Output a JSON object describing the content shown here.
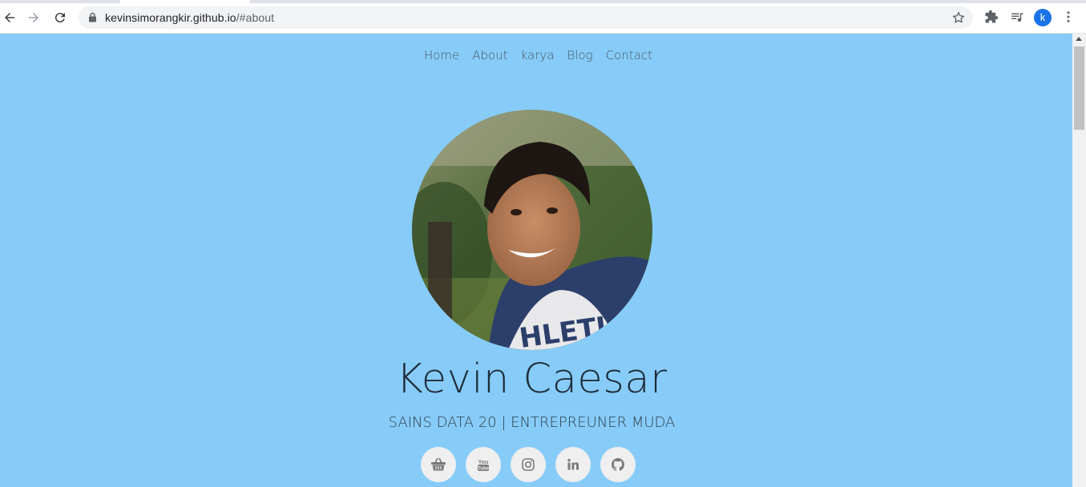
{
  "browser": {
    "url_host": "kevinsimorangkir.github.io",
    "url_path": "/#about",
    "profile_initial": "k"
  },
  "nav": {
    "items": [
      {
        "label": "Home"
      },
      {
        "label": "About"
      },
      {
        "label": "karya"
      },
      {
        "label": "Blog"
      },
      {
        "label": "Contact"
      }
    ]
  },
  "profile": {
    "name": "Kevin Caesar",
    "subtitle": "SAINS DATA 20 | ENTREPREUNER MUDA"
  },
  "socials": [
    {
      "icon": "shopping-basket-icon"
    },
    {
      "icon": "youtube-icon"
    },
    {
      "icon": "instagram-icon"
    },
    {
      "icon": "linkedin-icon"
    },
    {
      "icon": "github-icon"
    }
  ],
  "colors": {
    "background": "#87ccf8",
    "nav_text": "#4b5663",
    "name_text": "#1f2d3a",
    "social_bg": "#efefef",
    "social_icon": "#7a7a7a"
  }
}
